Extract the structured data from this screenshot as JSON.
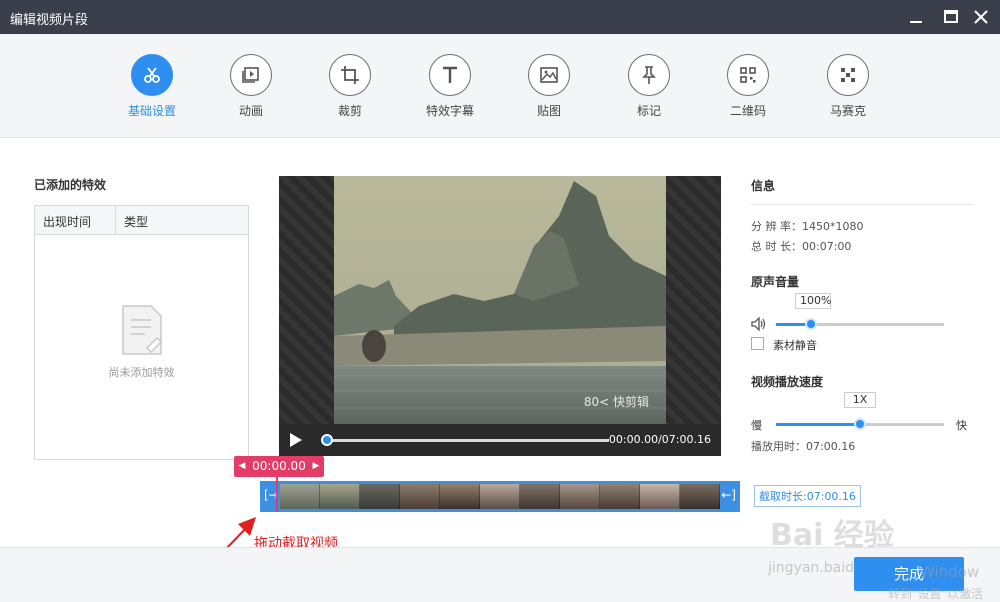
{
  "window": {
    "title": "编辑视频片段"
  },
  "toolbar": {
    "tabs": [
      {
        "label": "基础设置",
        "icon": "scissors-icon",
        "active": true
      },
      {
        "label": "动画",
        "icon": "animation-icon"
      },
      {
        "label": "裁剪",
        "icon": "crop-icon"
      },
      {
        "label": "特效字幕",
        "icon": "text-icon"
      },
      {
        "label": "贴图",
        "icon": "image-icon"
      },
      {
        "label": "标记",
        "icon": "pin-icon"
      },
      {
        "label": "二维码",
        "icon": "qrcode-icon"
      },
      {
        "label": "马赛克",
        "icon": "mosaic-icon"
      }
    ]
  },
  "effects_panel": {
    "title": "已添加的特效",
    "columns": [
      "出现时间",
      "类型"
    ],
    "empty_text": "尚未添加特效"
  },
  "player": {
    "watermark": "80< 快剪辑",
    "time": "00:00.00/07:00.16",
    "progress": 0
  },
  "timeline": {
    "current_time": "00:00.00",
    "cut_duration": "截取时长:07:00.16",
    "annotation": "拖动截取视频"
  },
  "info": {
    "heading": "信息",
    "resolution_label": "分 辨 率：",
    "resolution": "1450*1080",
    "duration_label": "总 时 长：",
    "duration": "00:07:00"
  },
  "volume": {
    "heading": "原声音量",
    "value": "100%",
    "level": 0.21,
    "mute_label": "素材静音"
  },
  "speed": {
    "heading": "视频播放速度",
    "value": "1X",
    "slow_label": "慢",
    "fast_label": "快",
    "level": 0.5,
    "playtime_label": "播放用时：",
    "playtime": "07:00.16"
  },
  "footer": {
    "done_label": "完成",
    "overlay_brand": "Bai 经验",
    "overlay_url": "jingyan.baidu.com",
    "overlay_windows": "Window",
    "overlay_activate": "转到\"设置\"以激活"
  }
}
